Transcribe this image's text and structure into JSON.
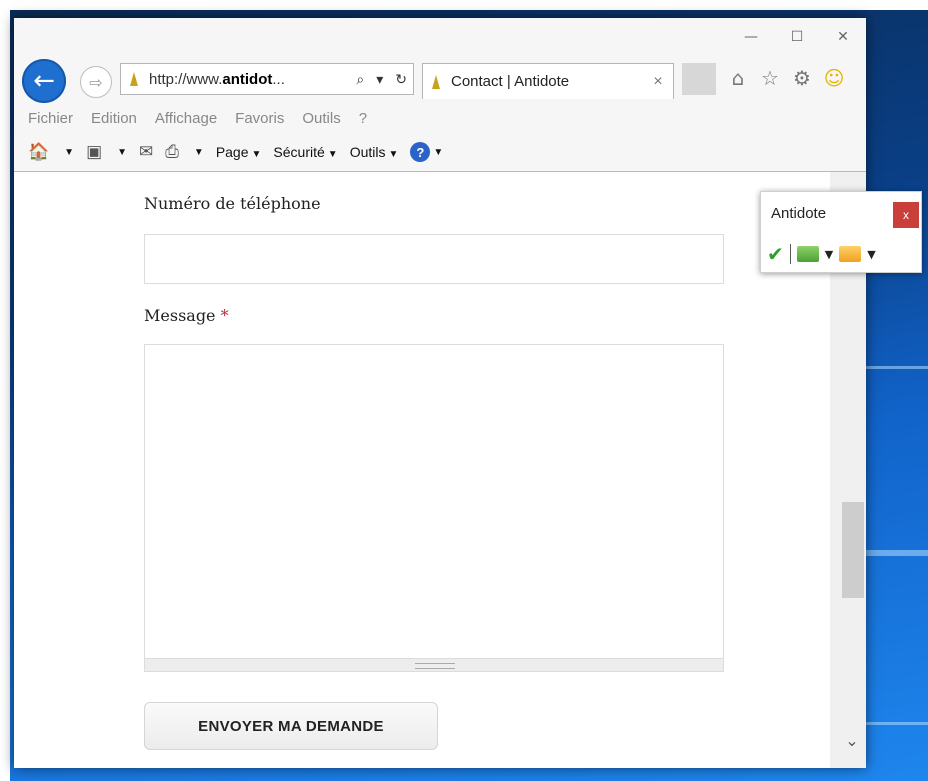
{
  "browser": {
    "address": {
      "prefix": "http://www.",
      "domain": "antidot",
      "suffix": "..."
    },
    "tab": {
      "title": "Contact | Antidote",
      "close": "×"
    },
    "window_controls": {
      "minimize": "—",
      "maximize": "☐",
      "close": "✕"
    },
    "menu": [
      "Fichier",
      "Edition",
      "Affichage",
      "Favoris",
      "Outils",
      "?"
    ],
    "commands": {
      "page": "Page",
      "security": "Sécurité",
      "tools": "Outils",
      "help": "?"
    }
  },
  "form": {
    "phone": {
      "label": "Numéro de téléphone",
      "value": ""
    },
    "message": {
      "label": "Message",
      "required_mark": "*",
      "value": ""
    },
    "submit_label": "ENVOYER MA DEMANDE"
  },
  "antidote_panel": {
    "title": "Antidote",
    "close": "x"
  },
  "colors": {
    "accent_blue": "#1e6fd0",
    "required_red": "#c0262d",
    "panel_close": "#c9403b",
    "check_green": "#2ea12a"
  }
}
